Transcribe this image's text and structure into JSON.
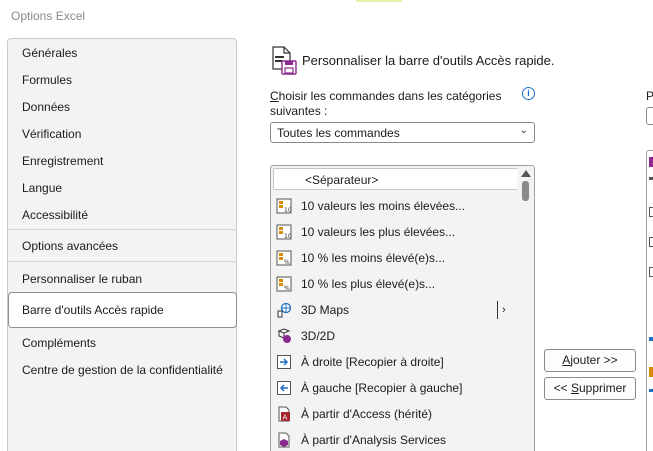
{
  "window": {
    "title": "Options Excel"
  },
  "nav": {
    "items": [
      {
        "label": "Générales"
      },
      {
        "label": "Formules"
      },
      {
        "label": "Données"
      },
      {
        "label": "Vérification"
      },
      {
        "label": "Enregistrement"
      },
      {
        "label": "Langue"
      },
      {
        "label": "Accessibilité"
      },
      {
        "label": "Options avancées"
      },
      {
        "label": "Personnaliser le ruban"
      },
      {
        "label": "Barre d'outils Accès rapide",
        "selected": true
      },
      {
        "label": "Compléments"
      },
      {
        "label": "Centre de gestion de la confidentialité"
      }
    ]
  },
  "main": {
    "title": "Personnaliser la barre d'outils Accès rapide.",
    "choose_label": "Choisir les commandes dans les catégories suivantes :",
    "choose_accesskey": "C",
    "category_select": {
      "value": "Toutes les commandes"
    },
    "commands": [
      {
        "label": "<Séparateur>",
        "icon": "none"
      },
      {
        "label": "10 valeurs les moins élevées...",
        "icon": "top10-icon"
      },
      {
        "label": "10 valeurs les plus élevées...",
        "icon": "top10-icon"
      },
      {
        "label": "10 % les moins élevé(e)s...",
        "icon": "top10-icon"
      },
      {
        "label": "10 % les plus élevé(e)s...",
        "icon": "top10-icon"
      },
      {
        "label": "3D Maps",
        "icon": "3d-maps-icon",
        "has_submenu": true
      },
      {
        "label": "3D/2D",
        "icon": "3d-2d-icon"
      },
      {
        "label": "À droite [Recopier à droite]",
        "icon": "fill-right-icon"
      },
      {
        "label": "À gauche [Recopier à gauche]",
        "icon": "fill-left-icon"
      },
      {
        "label": "À partir d'Access (hérité)",
        "icon": "access-icon"
      },
      {
        "label": "À partir d'Analysis Services",
        "icon": "analysis-services-icon"
      }
    ],
    "add_button": {
      "label": "Ajouter >>"
    },
    "remove_button": {
      "label": "<< Supprimer"
    }
  },
  "right_panel": {
    "label": "P"
  },
  "colors": {
    "accent": "#1f6fc4",
    "nav_bg": "#f3f3f3",
    "border": "#8a8a8a"
  }
}
